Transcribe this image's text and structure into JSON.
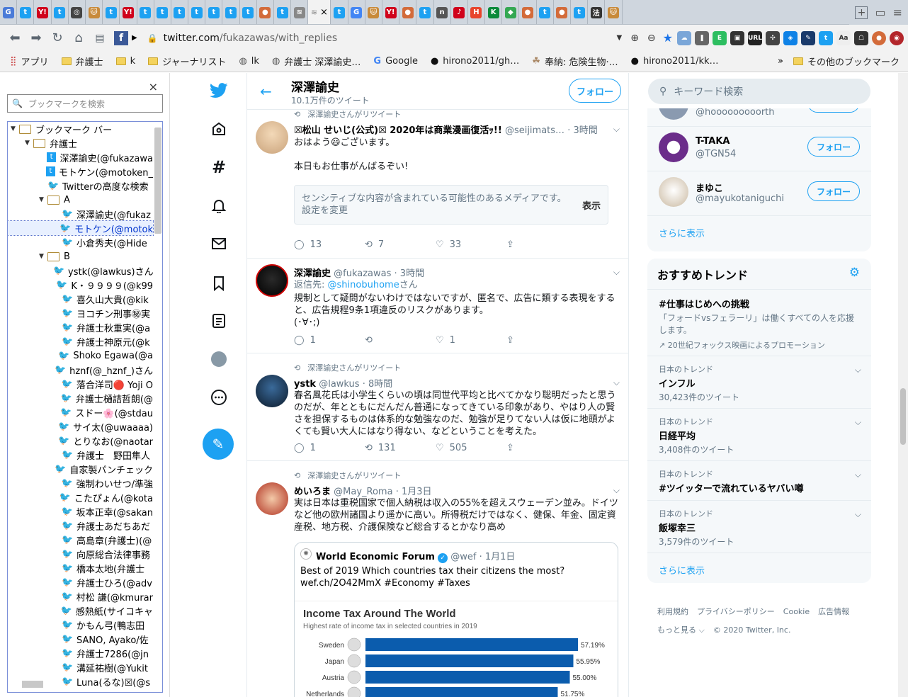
{
  "browser": {
    "url_host": "twitter.com",
    "url_path": "/fukazawas/with_replies",
    "tabs": [
      {
        "icon": "gmail",
        "color": "#4a7bd8",
        "txt": "G"
      },
      {
        "icon": "twitter",
        "color": "#1da1f2",
        "txt": "t"
      },
      {
        "icon": "yahoo",
        "color": "#d0021b",
        "txt": "Y!"
      },
      {
        "icon": "twitter",
        "color": "#1da1f2",
        "txt": "t"
      },
      {
        "icon": "compass",
        "color": "#444",
        "txt": "◎"
      },
      {
        "icon": "cat",
        "color": "#c88a3a",
        "txt": "🐱"
      },
      {
        "icon": "twitter",
        "color": "#1da1f2",
        "txt": "t"
      },
      {
        "icon": "yahoo",
        "color": "#d0021b",
        "txt": "Y!"
      },
      {
        "icon": "twitter",
        "color": "#1da1f2",
        "txt": "t"
      },
      {
        "icon": "twitter",
        "color": "#1da1f2",
        "txt": "t"
      },
      {
        "icon": "twitter",
        "color": "#1da1f2",
        "txt": "t"
      },
      {
        "icon": "twitter",
        "color": "#1da1f2",
        "txt": "t"
      },
      {
        "icon": "twitter",
        "color": "#1da1f2",
        "txt": "t"
      },
      {
        "icon": "twitter",
        "color": "#1da1f2",
        "txt": "t"
      },
      {
        "icon": "twitter",
        "color": "#1da1f2",
        "txt": "t"
      },
      {
        "icon": "avatar",
        "color": "#d36b3a",
        "txt": "●"
      },
      {
        "icon": "twitter",
        "color": "#1da1f2",
        "txt": "t"
      },
      {
        "icon": "page",
        "color": "#888",
        "txt": "≋"
      }
    ],
    "tabs_after": [
      {
        "icon": "twitter",
        "color": "#1da1f2",
        "txt": "t"
      },
      {
        "icon": "google",
        "color": "#4285f4",
        "txt": "G"
      },
      {
        "icon": "cat",
        "color": "#c88a3a",
        "txt": "🐱"
      },
      {
        "icon": "yahoo",
        "color": "#d0021b",
        "txt": "Y!"
      },
      {
        "icon": "avatar",
        "color": "#d36b3a",
        "txt": "●"
      },
      {
        "icon": "twitter",
        "color": "#1da1f2",
        "txt": "t"
      },
      {
        "icon": "note",
        "color": "#555",
        "txt": "n"
      },
      {
        "icon": "music",
        "color": "#d0021b",
        "txt": "♪"
      },
      {
        "icon": "hotpepper",
        "color": "#e8442c",
        "txt": "H"
      },
      {
        "icon": "k",
        "color": "#0a8a3a",
        "txt": "K"
      },
      {
        "icon": "maps",
        "color": "#34a853",
        "txt": "◆"
      },
      {
        "icon": "avatar",
        "color": "#d36b3a",
        "txt": "●"
      },
      {
        "icon": "twitter",
        "color": "#1da1f2",
        "txt": "t"
      },
      {
        "icon": "avatar",
        "color": "#d36b3a",
        "txt": "●"
      },
      {
        "icon": "twitter",
        "color": "#1da1f2",
        "txt": "t"
      },
      {
        "icon": "law",
        "color": "#333",
        "txt": "法"
      },
      {
        "icon": "cat",
        "color": "#c88a3a",
        "txt": "🐱"
      }
    ],
    "bookmarks": [
      "アプリ",
      "弁護士",
      "k",
      "ジャーナリスト",
      "lk",
      "弁護士 深澤諭史…",
      "Google",
      "hirono2011/gh…",
      "奉納: 危険生物·…",
      "hirono2011/kk…"
    ],
    "bookmarks_more": "»",
    "bookmarks_other": "その他のブックマーク"
  },
  "sidebar": {
    "search_placeholder": "ブックマークを検索",
    "close": "×",
    "tree": [
      {
        "indent": 0,
        "type": "folder",
        "open": true,
        "label": "ブックマーク バー"
      },
      {
        "indent": 1,
        "type": "folder",
        "open": true,
        "label": "弁護士"
      },
      {
        "indent": 2,
        "type": "tw2",
        "label": "深澤諭史(@fukazawa"
      },
      {
        "indent": 2,
        "type": "tw2",
        "label": "モトケン(@motoken_"
      },
      {
        "indent": 2,
        "type": "tw",
        "label": "Twitterの高度な検索"
      },
      {
        "indent": 2,
        "type": "folder",
        "open": true,
        "label": "A"
      },
      {
        "indent": 3,
        "type": "tw",
        "label": "深澤諭史(@fukaz"
      },
      {
        "indent": 3,
        "type": "tw",
        "label": "モトケン(@motok",
        "selected": true
      },
      {
        "indent": 3,
        "type": "tw",
        "label": "小倉秀夫(@Hide"
      },
      {
        "indent": 2,
        "type": "folder",
        "open": true,
        "label": "B"
      },
      {
        "indent": 3,
        "type": "tw",
        "label": "ystk(@lawkus)さん"
      },
      {
        "indent": 3,
        "type": "tw",
        "label": "K・９９９９(@k99"
      },
      {
        "indent": 3,
        "type": "tw",
        "label": "喜久山大貴(@kik"
      },
      {
        "indent": 3,
        "type": "tw",
        "label": "ヨコチン刑事㊙実"
      },
      {
        "indent": 3,
        "type": "tw",
        "label": "弁護士秋重実(@a"
      },
      {
        "indent": 3,
        "type": "tw",
        "label": "弁護士神原元(@k"
      },
      {
        "indent": 3,
        "type": "tw",
        "label": "Shoko Egawa(@a"
      },
      {
        "indent": 3,
        "type": "tw",
        "label": "hznf(@_hznf_)さん"
      },
      {
        "indent": 3,
        "type": "tw",
        "label": "落合洋司🔴 Yoji O"
      },
      {
        "indent": 3,
        "type": "tw",
        "label": "弁護士樋詰哲朗(@"
      },
      {
        "indent": 3,
        "type": "tw",
        "label": "スドー🌸(@stdau"
      },
      {
        "indent": 3,
        "type": "tw",
        "label": "サイ太(@uwaaaa)"
      },
      {
        "indent": 3,
        "type": "tw",
        "label": "とりなお(@naotar"
      },
      {
        "indent": 3,
        "type": "tw",
        "label": "弁護士　野田隼人"
      },
      {
        "indent": 3,
        "type": "tw",
        "label": "自家製パンチェック"
      },
      {
        "indent": 3,
        "type": "tw",
        "label": "強制わいせつ/準強"
      },
      {
        "indent": 3,
        "type": "tw",
        "label": "こたぴょん(@kota"
      },
      {
        "indent": 3,
        "type": "tw",
        "label": "坂本正幸(@sakan"
      },
      {
        "indent": 3,
        "type": "tw",
        "label": "弁護士あだちあだ"
      },
      {
        "indent": 3,
        "type": "tw",
        "label": "高島章(弁護士)(@"
      },
      {
        "indent": 3,
        "type": "tw",
        "label": "向原総合法律事務"
      },
      {
        "indent": 3,
        "type": "tw",
        "label": "橋本太地(弁護士"
      },
      {
        "indent": 3,
        "type": "tw",
        "label": "弁護士ひろ(@adv"
      },
      {
        "indent": 3,
        "type": "tw",
        "label": "村松 謙(@kmurar"
      },
      {
        "indent": 3,
        "type": "tw",
        "label": "感熱紙(サイコキャ"
      },
      {
        "indent": 3,
        "type": "tw",
        "label": "かもん弓(鴨志田"
      },
      {
        "indent": 3,
        "type": "tw",
        "label": "SANO, Ayako/佐"
      },
      {
        "indent": 3,
        "type": "tw",
        "label": "弁護士7286(@jn"
      },
      {
        "indent": 3,
        "type": "tw",
        "label": "溝延祐樹(@Yukit"
      },
      {
        "indent": 3,
        "type": "tw",
        "label": "Luna(るな)☒(@s"
      }
    ]
  },
  "profile": {
    "name": "深澤諭史",
    "count": "10.1万件のツイート",
    "follow": "フォロー"
  },
  "tweets": [
    {
      "rt": "深澤諭史さんがリツイート",
      "name": "☒松山 せいじ(公式)☒ 2020年は商業漫画復活ｯ!!",
      "handle": "@seijimats…",
      "time": "· 3時間",
      "body": "おはよう😃ございます。\n\n本日もお仕事がんばるぞい!",
      "sensitive": "センシティブな内容が含まれている可能性のあるメディアです。設定を変更",
      "show": "表示",
      "reply": "13",
      "retweet": "7",
      "like": "33"
    },
    {
      "name": "深澤諭史",
      "handle": "@fukazawas",
      "time": "· 3時間",
      "reply_to_label": "返信先:",
      "reply_to": "@shinobuhome",
      "reply_to_suffix": "さん",
      "body": "規制として疑問がないわけではないですが、匿名で、広告に類する表現をすると、広告規程9条1項違反のリスクがあります。\n(･∀･;)",
      "reply": "1",
      "retweet": "",
      "like": "1"
    },
    {
      "rt": "深澤諭史さんがリツイート",
      "name": "ystk",
      "handle": "@lawkus",
      "time": "· 8時間",
      "body": "春名風花氏は小学生くらいの頃は同世代平均と比べてかなり聡明だったと思うのだが、年とともにだんだん普通になってきている印象があり、やはり人の賢さを担保するものは体系的な勉強なのだ、勉強が足りてない人は仮に地頭がよくても賢い大人にはなり得ない、などということを考えた。",
      "reply": "1",
      "retweet": "131",
      "like": "505"
    },
    {
      "rt": "深澤諭史さんがリツイート",
      "name": "めいろま",
      "handle": "@May_Roma",
      "time": "· 1月3日",
      "body": "実は日本は重税国家で個人納税は収入の55%を超えスウェーデン並み。ドイツなど他の欧州諸国より遥かに高い。所得税だけではなく、健保、年金、固定資産税、地方税、介護保険など総合するとかなり高め"
    }
  ],
  "quote": {
    "name": "World Economic Forum",
    "handle": "@wef",
    "time": "· 1月1日",
    "body": "Best of 2019 Which countries tax their citizens the most?\nwef.ch/2O42MmX #Economy #Taxes"
  },
  "chart_data": {
    "type": "bar",
    "title": "Income Tax Around The World",
    "subtitle": "Highest rate of income tax in selected countries in 2019",
    "categories": [
      "Sweden",
      "Japan",
      "Austria",
      "Netherlands"
    ],
    "values": [
      57.19,
      55.95,
      55.0,
      51.75
    ],
    "labels": [
      "57.19%",
      "55.95%",
      "55.00%",
      "51.75%"
    ],
    "bar_color": "#0b5cad",
    "orientation": "horizontal"
  },
  "right": {
    "search_placeholder": "キーワード検索",
    "who": [
      {
        "name": "",
        "handle": "@hooooooooorth",
        "color": "#8a9ab0",
        "partial": true
      },
      {
        "name": "T-TAKA",
        "handle": "@TGN54",
        "color": "#6b2d8a",
        "follow": "フォロー"
      },
      {
        "name": "まゆこ",
        "handle": "@mayukotaniguchi",
        "color": "#c9b8a0",
        "follow": "フォロー"
      }
    ],
    "show_more": "さらに表示",
    "trends_title": "おすすめトレンド",
    "promo": {
      "title": "#仕事はじめへの挑戦",
      "desc": "「フォードvsフェラーリ」は働くすべての人を応援します。",
      "by": "20世紀フォックス映画によるプロモーション"
    },
    "trends": [
      {
        "meta": "日本のトレンド",
        "title": "インフル",
        "count": "30,423件のツイート"
      },
      {
        "meta": "日本のトレンド",
        "title": "日経平均",
        "count": "3,408件のツイート"
      },
      {
        "meta": "日本のトレンド",
        "title": "#ツイッターで流れているヤバい噂",
        "count": ""
      },
      {
        "meta": "日本のトレンド",
        "title": "飯塚幸三",
        "count": "3,579件のツイート"
      }
    ],
    "show_more2": "さらに表示",
    "footer": [
      "利用規約",
      "プライバシーポリシー",
      "Cookie",
      "広告情報",
      "もっと見る ⌵",
      "© 2020 Twitter, Inc."
    ]
  }
}
